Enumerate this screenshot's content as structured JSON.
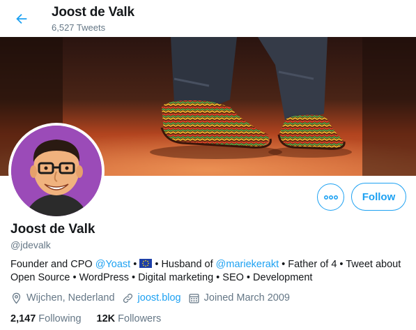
{
  "header": {
    "title": "Joost de Valk",
    "tweet_count": "6,527 Tweets",
    "back_icon": "arrow-left-icon"
  },
  "colors": {
    "accent": "#1da1f2",
    "muted": "#657786",
    "text": "#14171a"
  },
  "profile": {
    "name": "Joost de Valk",
    "handle": "@jdevalk",
    "follow_label": "Follow",
    "more_icon": "more-dots-icon"
  },
  "bio": {
    "p1": "Founder and CPO ",
    "mention1": "@Yoast",
    "p2": " • ",
    "flag_icon": "eu-flag-icon",
    "p3": " • Husband of ",
    "mention2": "@mariekerakt",
    "p4": " • Father of 4 • Tweet about Open Source • WordPress • Digital marketing • SEO • Development"
  },
  "meta": {
    "location": "Wijchen, Nederland",
    "website": "joost.blog",
    "joined": "Joined March 2009"
  },
  "stats": {
    "following_count": "2,147",
    "following_label": "Following",
    "followers_count": "12K",
    "followers_label": "Followers"
  }
}
